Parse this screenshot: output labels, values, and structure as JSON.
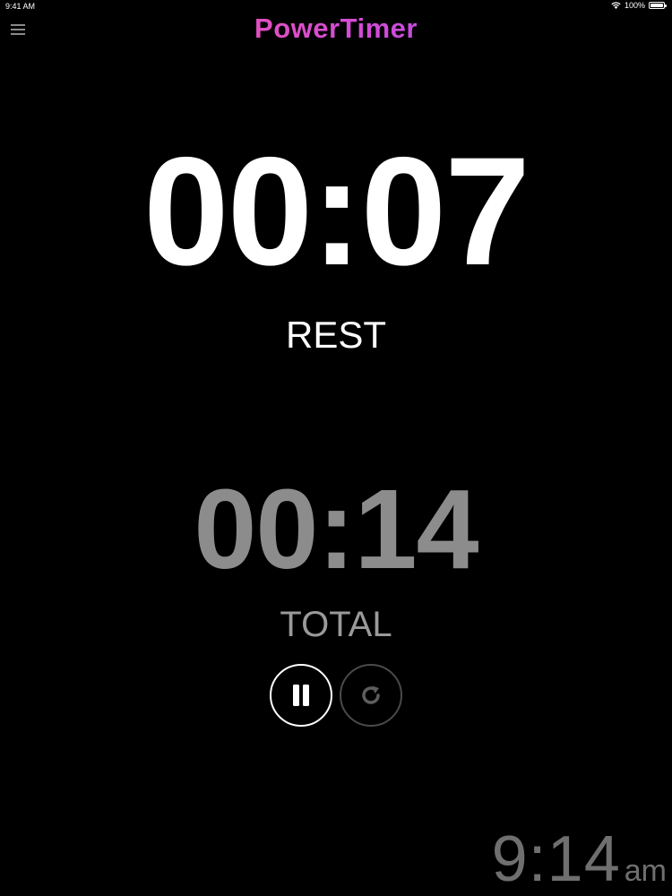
{
  "status_bar": {
    "time": "9:41 AM",
    "battery": "100%",
    "battery_level": 1.0
  },
  "header": {
    "title": "PowerTimer",
    "menu_icon": "hamburger-menu-icon",
    "title_gradient": [
      "#ff5a8c",
      "#d24bd8",
      "#8b5cf6"
    ]
  },
  "timer": {
    "current": "00:07",
    "phase": "REST",
    "total": "00:14",
    "total_label": "TOTAL"
  },
  "controls": {
    "pause_icon": "pause-icon",
    "reset_icon": "refresh-icon"
  },
  "clock": {
    "time": "9:14",
    "ampm": "am"
  },
  "colors": {
    "background": "#000000",
    "primary_text": "#ffffff",
    "secondary_text": "#8c8c8c",
    "clock_text": "#6f6f6f"
  }
}
